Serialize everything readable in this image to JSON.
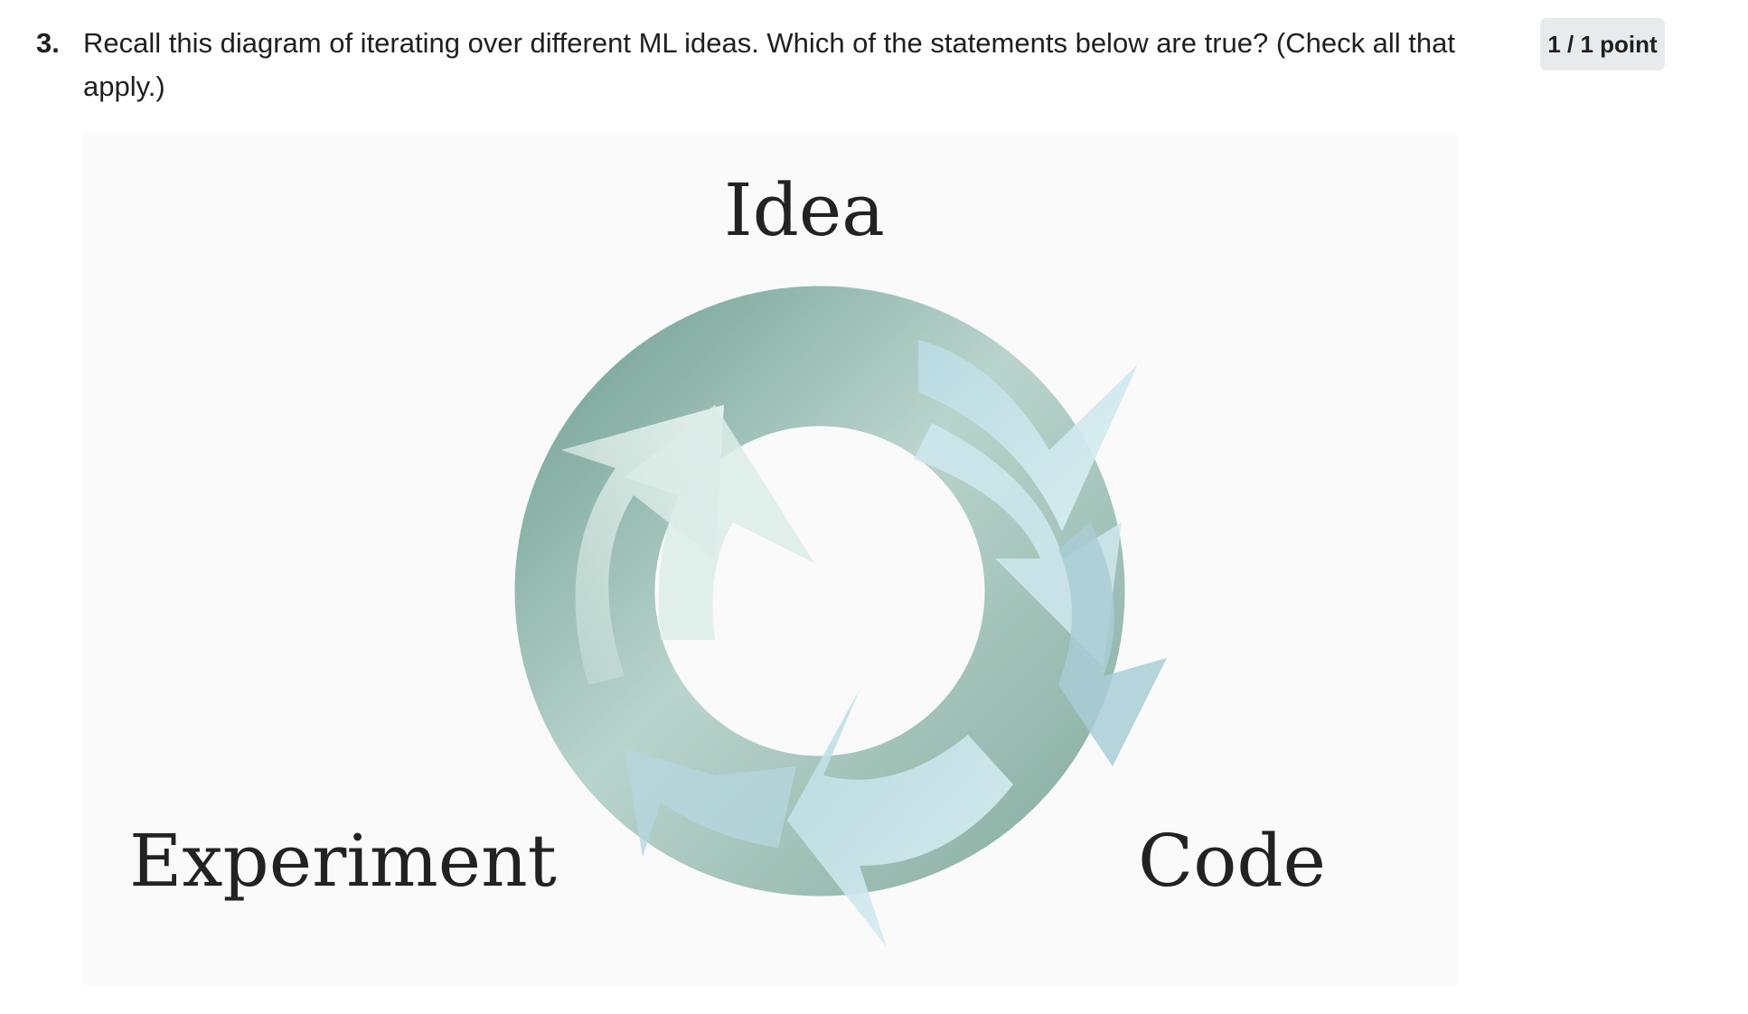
{
  "question": {
    "number": "3.",
    "text": "Recall this diagram of iterating over different ML ideas. Which of the statements below are true? (Check all that apply.)",
    "points": "1 / 1 point"
  },
  "diagram": {
    "labels": {
      "idea": "Idea",
      "experiment": "Experiment",
      "code": "Code"
    },
    "colors": {
      "ring_dark": "#8fb3a8",
      "ring_light": "#cfe3dc",
      "arrow_light": "#d6eef3",
      "arrow_pale": "#e4f2ee"
    }
  }
}
